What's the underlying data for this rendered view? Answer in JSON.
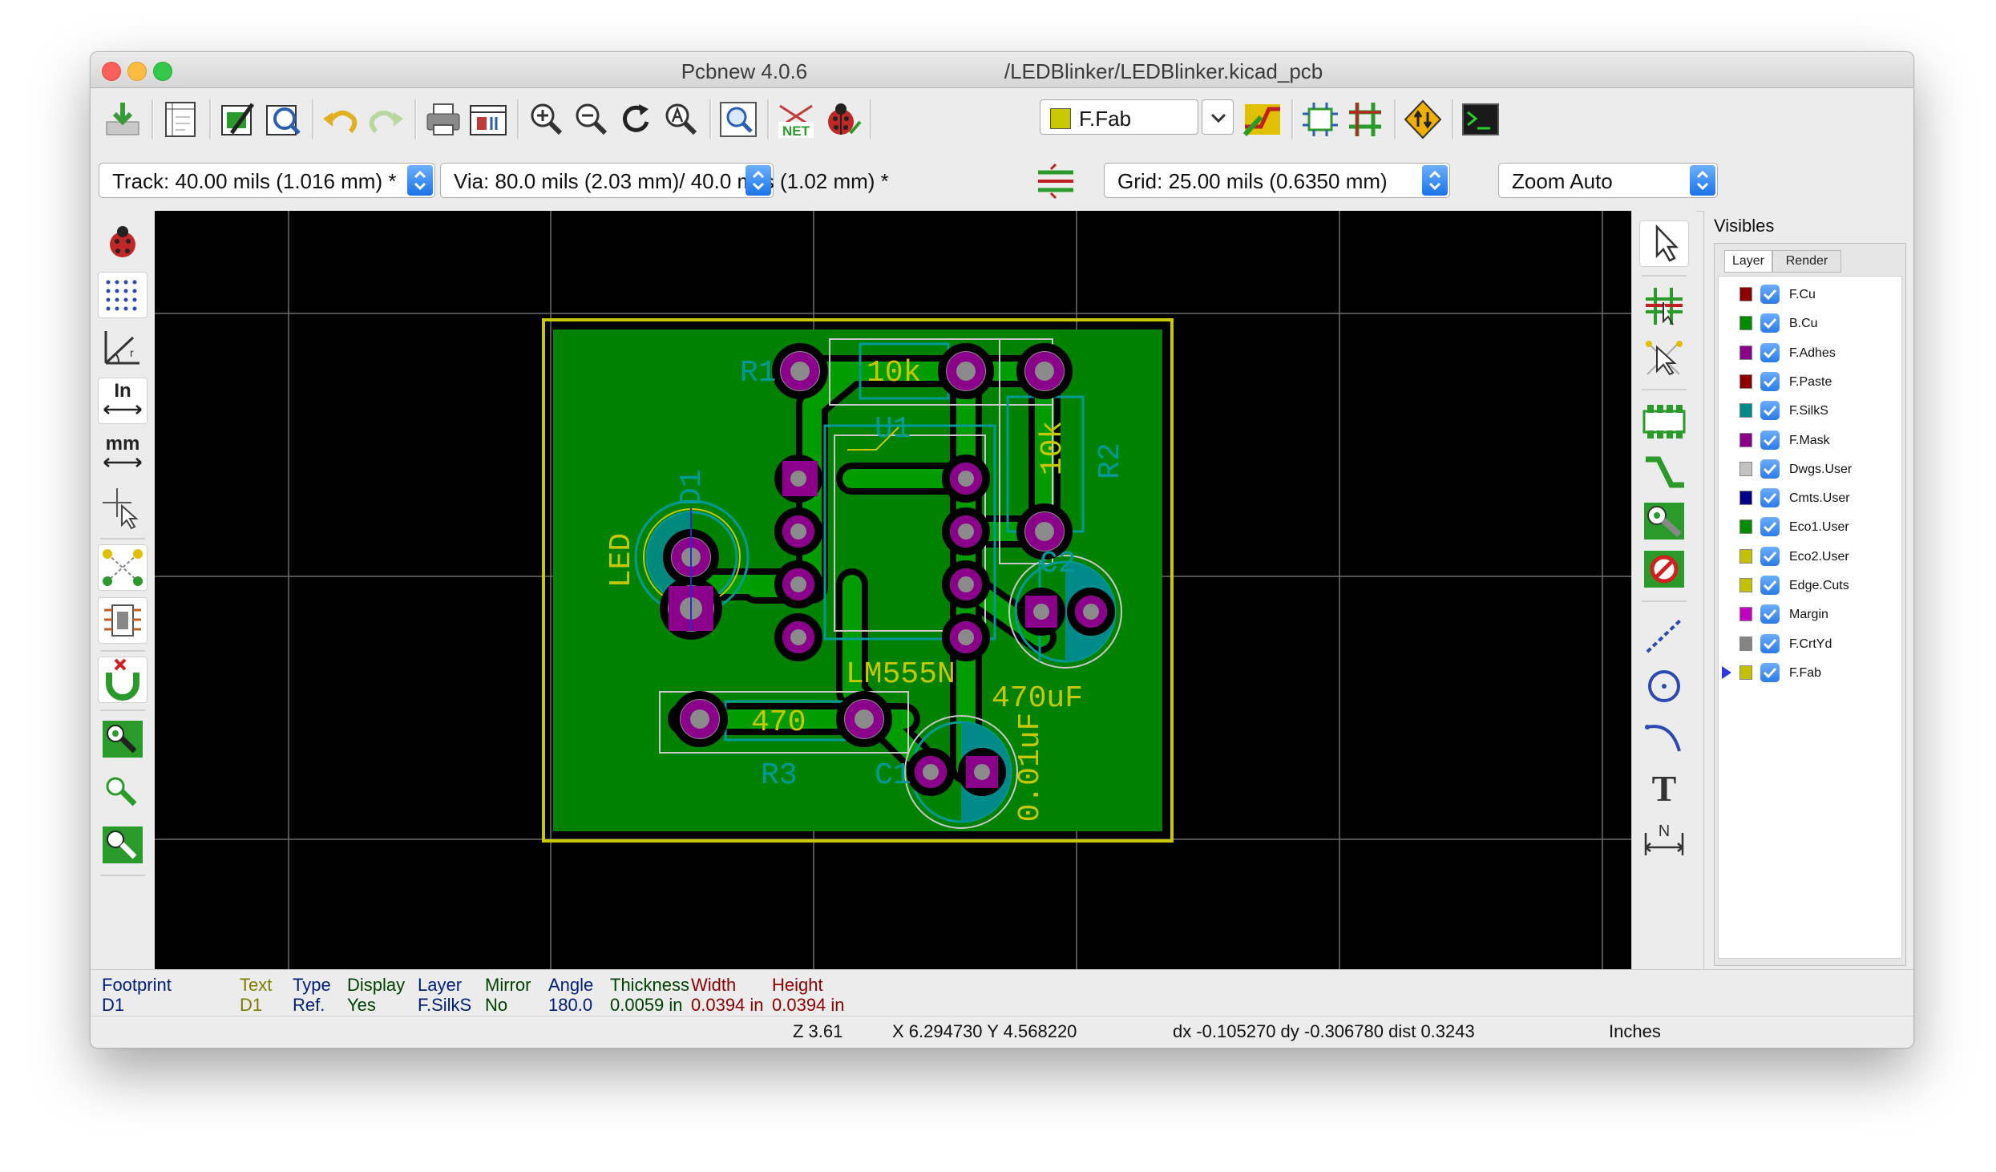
{
  "window": {
    "title": "Pcbnew 4.0.6                                  /LEDBlinker/LEDBlinker.kicad_pcb"
  },
  "toolbar": {
    "active_layer": "F.Fab",
    "layer_color": "#c8c800"
  },
  "settings": {
    "track": "Track: 40.00 mils (1.016 mm) *",
    "via": "Via: 80.0 mils (2.03 mm)/ 40.0 mils (1.02 mm) *",
    "grid": "Grid: 25.00 mils (0.6350 mm)",
    "zoom": "Zoom Auto"
  },
  "left_toolbar": {
    "inch_label": "In",
    "mm_label": "mm"
  },
  "right_toolbar": {
    "text_tool_label": "T",
    "dim_label": "N"
  },
  "visibles": {
    "title": "Visibles",
    "tabs": [
      "Layer",
      "Render"
    ],
    "layers": [
      {
        "name": "F.Cu",
        "color": "#8b0000"
      },
      {
        "name": "B.Cu",
        "color": "#008b00"
      },
      {
        "name": "F.Adhes",
        "color": "#8b008b"
      },
      {
        "name": "F.Paste",
        "color": "#8b0000"
      },
      {
        "name": "F.SilkS",
        "color": "#008b8b"
      },
      {
        "name": "F.Mask",
        "color": "#8b008b"
      },
      {
        "name": "Dwgs.User",
        "color": "#c2c2c2"
      },
      {
        "name": "Cmts.User",
        "color": "#00008b"
      },
      {
        "name": "Eco1.User",
        "color": "#008b00"
      },
      {
        "name": "Eco2.User",
        "color": "#c2c200"
      },
      {
        "name": "Edge.Cuts",
        "color": "#c2c200"
      },
      {
        "name": "Margin",
        "color": "#c200c2"
      },
      {
        "name": "F.CrtYd",
        "color": "#848484"
      },
      {
        "name": "F.Fab",
        "color": "#c2c200"
      }
    ]
  },
  "pcb": {
    "labels": {
      "r1_ref": "R1",
      "r1_val": "10k",
      "u1_ref": "U1",
      "u1_val": "LM555N",
      "r2_ref": "R2",
      "r2_val": "10k",
      "d1_ref": "D1",
      "d1_val": "LED",
      "c2_ref": "C2",
      "c2_val": "470uF",
      "r3_ref": "R3",
      "r3_val": "470",
      "c1_ref": "C1",
      "c1_val": "0.01uF"
    }
  },
  "message_panel": {
    "columns": [
      {
        "header": "Footprint",
        "value": "D1",
        "color": "#001e78"
      },
      {
        "header": "Text",
        "value": "D1",
        "color": "#7d7d00"
      },
      {
        "header": "Type",
        "value": "Ref.",
        "color": "#001e78"
      },
      {
        "header": "Display",
        "value": "Yes",
        "color": "#004000"
      },
      {
        "header": "Layer",
        "value": "F.SilkS",
        "color": "#001e78"
      },
      {
        "header": "Mirror",
        "value": "No",
        "color": "#004000"
      },
      {
        "header": "Angle",
        "value": "180.0",
        "color": "#001e78"
      },
      {
        "header": "Thickness",
        "value": "0.0059 in",
        "color": "#004000"
      },
      {
        "header": "Width",
        "value": "0.0394 in",
        "color": "#8b0000"
      },
      {
        "header": "Height",
        "value": "0.0394 in",
        "color": "#8b0000"
      }
    ]
  },
  "status": {
    "zoom": "Z 3.61",
    "coords": "X 6.294730  Y 4.568220",
    "delta": "dx -0.105270  dy -0.306780  dist 0.3243",
    "units": "Inches"
  }
}
